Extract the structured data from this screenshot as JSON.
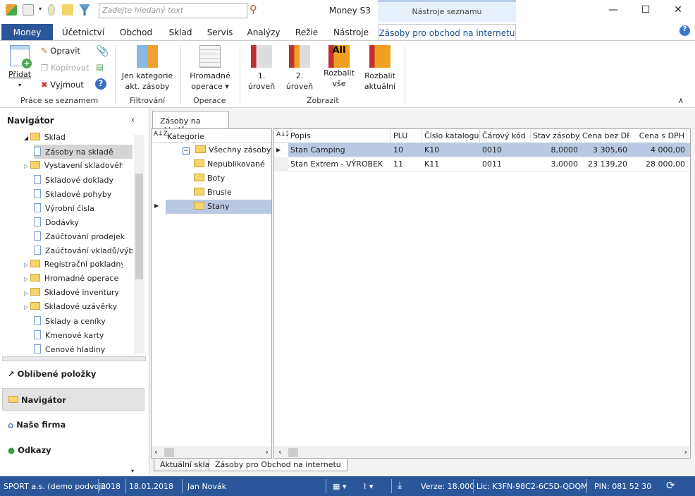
{
  "titlebar": {
    "search_placeholder": "Zadejte hledaný text",
    "app_title": "Money S3",
    "context_title": "Nástroje seznamu",
    "minimize": "—",
    "maximize": "☐",
    "close": "✕"
  },
  "tabs": [
    "Money",
    "Účetnictví",
    "Obchod",
    "Sklad",
    "Servis",
    "Analýzy",
    "Režie",
    "Nástroje",
    "Zásoby pro obchod na internetu"
  ],
  "ribbon": {
    "pridat": "Přidat",
    "opravit": "Opravit",
    "kopirovat": "Kopírovat",
    "vyjmout": "Vyjmout",
    "group1": "Práce se seznamem",
    "jen_kategorie": [
      "Jen kategorie",
      "akt. zásoby"
    ],
    "group2": "Filtrování",
    "hromadne": [
      "Hromadné",
      "operace ▾"
    ],
    "group3": "Operace",
    "uroven1": [
      "1.",
      "úroveň"
    ],
    "uroven2": [
      "2.",
      "úroveň"
    ],
    "rozbalit_vse": [
      "Rozbalit",
      "vše"
    ],
    "rozbalit_akt": [
      "Rozbalit",
      "aktuální"
    ],
    "group4": "Zobrazit",
    "all_glyph": "All"
  },
  "navigator": {
    "title": "Navigátor",
    "parent": "Sklad",
    "items": [
      {
        "label": "Zásoby na skladě",
        "type": "doc",
        "selected": true
      },
      {
        "label": "Vystavení skladového dok",
        "type": "folder"
      },
      {
        "label": "Skladové doklady",
        "type": "doc"
      },
      {
        "label": "Skladové pohyby",
        "type": "doc"
      },
      {
        "label": "Výrobní čísla",
        "type": "doc"
      },
      {
        "label": "Dodávky",
        "type": "doc"
      },
      {
        "label": "Zaúčtování prodejek",
        "type": "doc"
      },
      {
        "label": "Zaúčtování vkladů/výběrů",
        "type": "doc"
      },
      {
        "label": "Registrační pokladny",
        "type": "folder"
      },
      {
        "label": "Hromadné operace",
        "type": "folder"
      },
      {
        "label": "Skladové inventury",
        "type": "folder"
      },
      {
        "label": "Skladové uzávěrky",
        "type": "folder"
      },
      {
        "label": "Sklady a ceníky",
        "type": "doc"
      },
      {
        "label": "Kmenové karty",
        "type": "doc"
      },
      {
        "label": "Cenové hladiny",
        "type": "doc"
      }
    ],
    "bottom": [
      "Oblíbené položky",
      "Navigátor",
      "Naše firma",
      "Odkazy"
    ]
  },
  "main": {
    "tab": "Zásoby na skladě",
    "categories": {
      "header": "Kategorie",
      "items": [
        "Všechny zásoby",
        "Nepublikované",
        "Boty",
        "Brusle",
        "Stany"
      ],
      "selected": "Stany"
    },
    "grid": {
      "columns": [
        "Popis",
        "PLU",
        "Číslo katalogu",
        "Čárový kód",
        "Stav zásoby",
        "Cena bez DPH",
        "Cena s DPH"
      ],
      "rows": [
        [
          "Stan Camping",
          "10",
          "K10",
          "0010",
          "8,0000",
          "3 305,60",
          "4 000,00"
        ],
        [
          "Stan Extrem - VÝROBEK",
          "11",
          "K11",
          "0011",
          "3,0000",
          "23 139,20",
          "28 000,00"
        ]
      ]
    },
    "bottom_tabs": [
      "Aktuální sklad",
      "Zásoby pro Obchod na internetu"
    ]
  },
  "status": {
    "company": "SPORT a.s. (demo podvojn",
    "year": "2018",
    "date": "18.01.2018",
    "user": "Jan Novák",
    "version": "Verze: 18.000",
    "license": "Lic: K3FN-98C2-6C5D-QDQM",
    "pin": "PIN: 081 52 30"
  },
  "colors": {
    "accent": "#2b579a",
    "selection": "#b9c9e3"
  }
}
